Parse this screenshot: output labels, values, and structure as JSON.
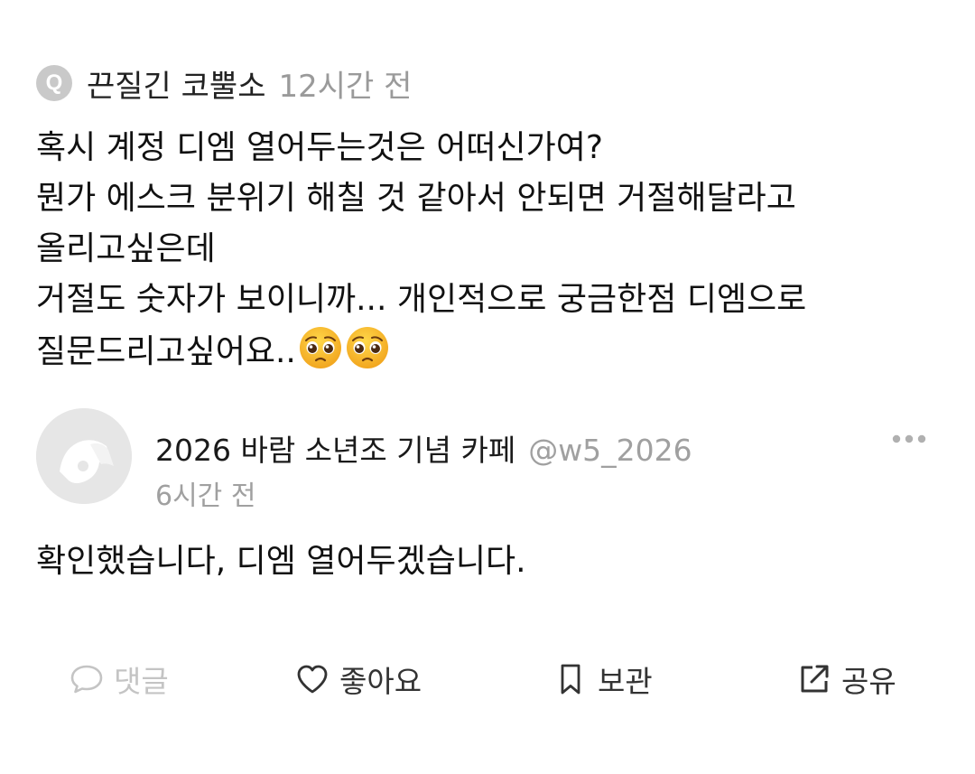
{
  "question": {
    "badge": "Q",
    "author": "끈질긴 코뿔소",
    "time": "12시간 전",
    "lines": [
      "혹시 계정 디엠 열어두는것은 어떠신가여?",
      "뭔가 에스크 분위기 해칠 것 같아서 안되면 거절해달라고",
      "올리고싶은데",
      "거절도 숫자가 보이니까... 개인적으로 궁금한점 디엠으로",
      "질문드리고싶어요.."
    ],
    "emoji": [
      "pleading-face-emoji",
      "pleading-face-emoji"
    ]
  },
  "reply": {
    "name": "2026 바람 소년조 기념 카페",
    "handle": "@w5_2026",
    "time": "6시간 전",
    "text": "확인했습니다, 디엠 열어두겠습니다."
  },
  "actions": {
    "comment": {
      "label": "댓글",
      "icon": "speech-bubble-icon"
    },
    "like": {
      "label": "좋아요",
      "icon": "heart-icon"
    },
    "bookmark": {
      "label": "보관",
      "icon": "bookmark-icon"
    },
    "share": {
      "label": "공유",
      "icon": "share-icon"
    }
  },
  "colors": {
    "text": "#111111",
    "muted": "#9a9a9a",
    "disabled": "#c4c4c4",
    "badge": "#c9c9c9",
    "avatar_bg": "#e6e6e6",
    "emoji_yellow": "#f7b72d"
  }
}
